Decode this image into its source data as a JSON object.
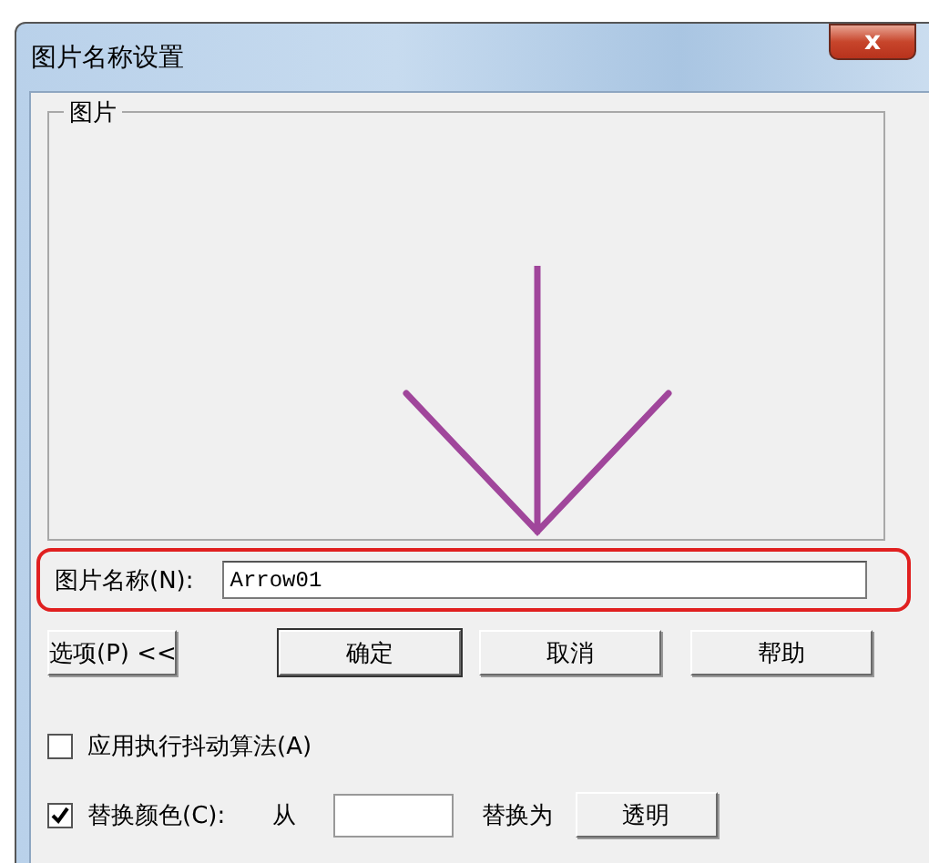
{
  "window": {
    "title": "图片名称设置",
    "close": "x"
  },
  "picture_group": {
    "label": "图片"
  },
  "name_field": {
    "label": "图片名称(N):",
    "value": "Arrow01",
    "highlighted": true
  },
  "buttons": [
    {
      "label": "选项(P) <<",
      "default": false
    },
    {
      "label": "确定",
      "default": true
    },
    {
      "label": "取消",
      "default": false
    },
    {
      "label": "帮助",
      "default": false
    }
  ],
  "dither": {
    "label": "应用执行抖动算法(A)",
    "checked": false
  },
  "replace": {
    "label": "替换颜色(C):",
    "checked": true,
    "from_label": "从",
    "to_label": "替换为",
    "to_button": "透明"
  }
}
